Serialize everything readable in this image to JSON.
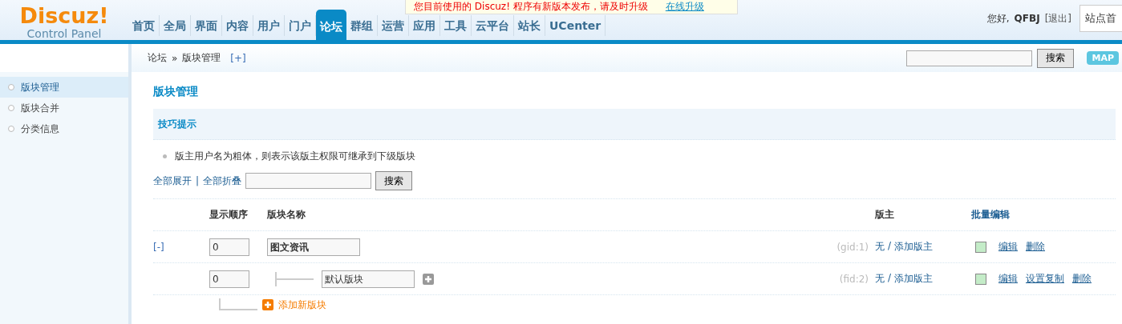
{
  "notice": {
    "text": "您目前使用的 Discuz! 程序有新版本发布，请及时升级",
    "link": "在线升级"
  },
  "logo": {
    "title": "Discuz!",
    "subtitle": "Control Panel"
  },
  "nav": [
    {
      "label": "首页",
      "selected": false
    },
    {
      "label": "全局",
      "selected": false
    },
    {
      "label": "界面",
      "selected": false
    },
    {
      "label": "内容",
      "selected": false
    },
    {
      "label": "用户",
      "selected": false
    },
    {
      "label": "门户",
      "selected": false
    },
    {
      "label": "论坛",
      "selected": true
    },
    {
      "label": "群组",
      "selected": false
    },
    {
      "label": "运营",
      "selected": false
    },
    {
      "label": "应用",
      "selected": false
    },
    {
      "label": "工具",
      "selected": false
    },
    {
      "label": "云平台",
      "selected": false
    },
    {
      "label": "站长",
      "selected": false
    },
    {
      "label": "UCenter",
      "selected": false
    }
  ],
  "user": {
    "greeting": "您好,",
    "name": "QFBJ",
    "logout": "[退出]",
    "site_button": "站点首"
  },
  "breadcrumb": {
    "items": [
      "论坛",
      "»",
      "版块管理"
    ],
    "add": "[+]"
  },
  "top_search": {
    "button": "搜索",
    "map": "MAP"
  },
  "sidebar": {
    "items": [
      {
        "label": "版块管理",
        "selected": true
      },
      {
        "label": "版块合并",
        "selected": false
      },
      {
        "label": "分类信息",
        "selected": false
      }
    ]
  },
  "page_title": "版块管理",
  "tips": {
    "title": "技巧提示",
    "items": [
      "版主用户名为粗体，则表示该版主权限可继承到下级版块"
    ]
  },
  "tools": {
    "expand": "全部展开",
    "sep": "|",
    "collapse": "全部折叠",
    "button": "搜索"
  },
  "table": {
    "columns": [
      "显示顺序",
      "版块名称",
      "版主",
      "批量编辑"
    ],
    "rows": [
      {
        "kind": "group",
        "toggle": "[-]",
        "order": "0",
        "name": "图文资讯",
        "id": "(gid:1)",
        "mod_none": "无",
        "mod_sep": "/",
        "mod_add": "添加版主",
        "checked": false,
        "actions": [
          "编辑",
          "删除"
        ]
      },
      {
        "kind": "forum",
        "order": "0",
        "name": "默认版块",
        "id": "(fid:2)",
        "mod_none": "无",
        "mod_sep": "/",
        "mod_add": "添加版主",
        "checked": false,
        "actions": [
          "编辑",
          "设置复制",
          "删除"
        ]
      }
    ],
    "add_label": "添加新版块"
  }
}
